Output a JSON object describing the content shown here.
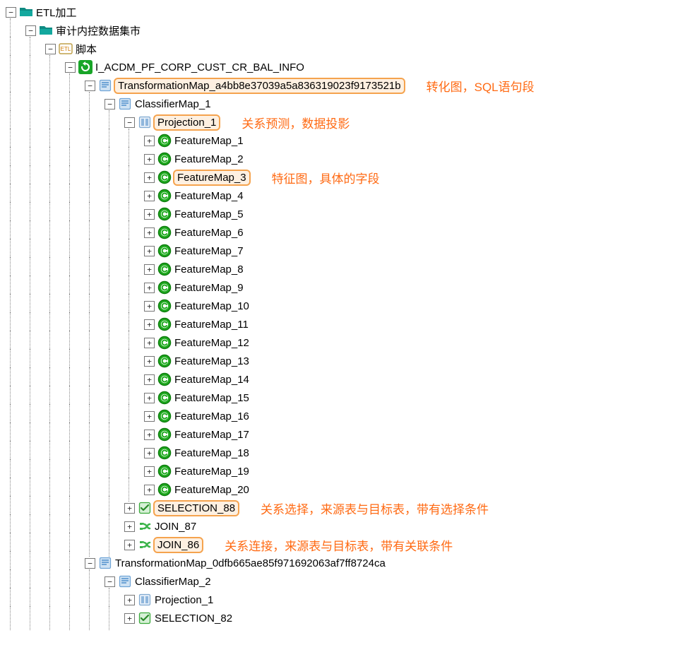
{
  "tree": {
    "level0": {
      "label": "ETL加工"
    },
    "level1": {
      "label": "审计内控数据集市"
    },
    "level2": {
      "label": "脚本"
    },
    "level3": {
      "label": "I_ACDM_PF_CORP_CUST_CR_BAL_INFO"
    },
    "tmap1": {
      "label": "TransformationMap_a4bb8e37039a5a836319023f9173521b",
      "ann": "转化图，SQL语句段"
    },
    "cmap1": {
      "label": "ClassifierMap_1"
    },
    "proj1": {
      "label": "Projection_1",
      "ann": "关系预测，数据投影"
    },
    "feature_labels": [
      "FeatureMap_1",
      "FeatureMap_2",
      "FeatureMap_3",
      "FeatureMap_4",
      "FeatureMap_5",
      "FeatureMap_6",
      "FeatureMap_7",
      "FeatureMap_8",
      "FeatureMap_9",
      "FeatureMap_10",
      "FeatureMap_11",
      "FeatureMap_12",
      "FeatureMap_13",
      "FeatureMap_14",
      "FeatureMap_15",
      "FeatureMap_16",
      "FeatureMap_17",
      "FeatureMap_18",
      "FeatureMap_19",
      "FeatureMap_20"
    ],
    "feature_ann_index": 2,
    "feature_ann": "特征图，具体的字段",
    "selection88": {
      "label": "SELECTION_88",
      "ann": "关系选择，来源表与目标表，带有选择条件"
    },
    "join87": {
      "label": "JOIN_87"
    },
    "join86": {
      "label": "JOIN_86",
      "ann": "关系连接，来源表与目标表，带有关联条件"
    },
    "tmap2": {
      "label": "TransformationMap_0dfb665ae85f971692063af7ff8724ca"
    },
    "cmap2": {
      "label": "ClassifierMap_2"
    },
    "proj2": {
      "label": "Projection_1"
    },
    "selection82": {
      "label": "SELECTION_82"
    }
  }
}
